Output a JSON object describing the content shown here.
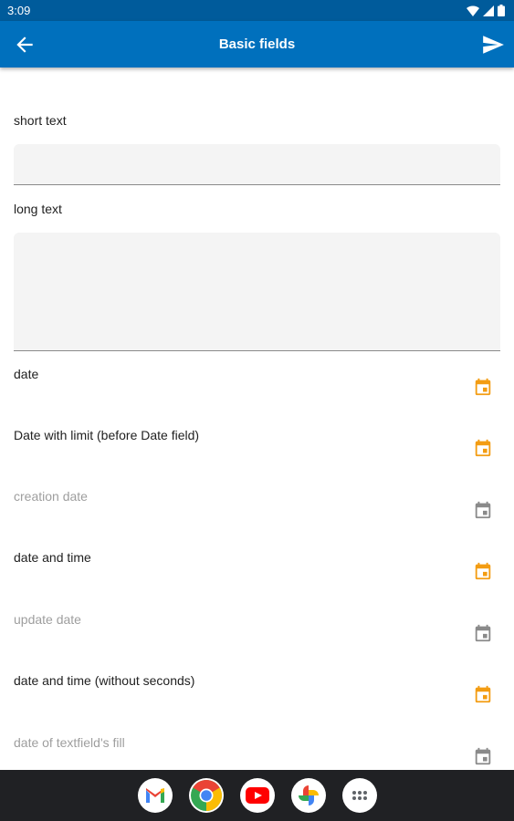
{
  "status_bar": {
    "time": "3:09"
  },
  "app_bar": {
    "title": "Basic fields"
  },
  "colors": {
    "app_bar": "#0070bd",
    "status_bar": "#005b9b",
    "calendar_active": "#f39c12",
    "calendar_disabled": "#8a8a8a"
  },
  "fields": {
    "short_text": {
      "label": "short text",
      "value": ""
    },
    "long_text": {
      "label": "long text",
      "value": ""
    },
    "date": {
      "label": "date"
    },
    "date_limit": {
      "label": "Date with limit (before Date field)"
    },
    "creation_date": {
      "label": "creation date"
    },
    "date_time": {
      "label": "date and time"
    },
    "update_date": {
      "label": "update date"
    },
    "date_time_no_seconds": {
      "label": "date and time (without seconds)"
    },
    "textfield_fill_date": {
      "label": "date of textfield's fill"
    }
  },
  "dock": {
    "apps": [
      "gmail-icon",
      "chrome-icon",
      "youtube-icon",
      "photos-icon",
      "app-drawer-icon"
    ]
  }
}
